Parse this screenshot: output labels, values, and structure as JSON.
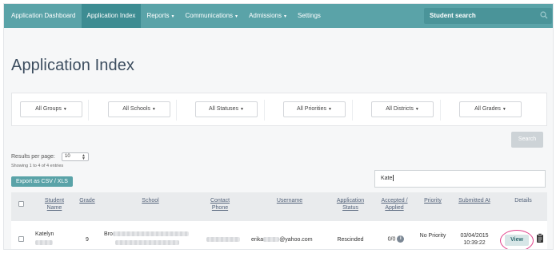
{
  "nav": {
    "items": [
      {
        "label": "Application Dashboard",
        "caret": false,
        "active": false
      },
      {
        "label": "Application Index",
        "caret": false,
        "active": true
      },
      {
        "label": "Reports",
        "caret": true,
        "active": false
      },
      {
        "label": "Communications",
        "caret": true,
        "active": false
      },
      {
        "label": "Admissions",
        "caret": true,
        "active": false
      },
      {
        "label": "Settings",
        "caret": false,
        "active": false
      }
    ],
    "search_placeholder": "Student search",
    "search_icon": "search-icon"
  },
  "page": {
    "title": "Application Index"
  },
  "filters": [
    {
      "label": "All Groups"
    },
    {
      "label": "All Schools"
    },
    {
      "label": "All Statuses"
    },
    {
      "label": "All Priorities"
    },
    {
      "label": "All Districts"
    },
    {
      "label": "All Grades"
    }
  ],
  "search_button": "Search",
  "results": {
    "per_page_label": "Results per page:",
    "per_page_value": "10",
    "entries_info": "Showing 1 to 4 of 4 entries",
    "export_label": "Export as CSV / XLS",
    "filter_value": "Kate"
  },
  "table": {
    "headers": {
      "student_name": "Student Name",
      "grade": "Grade",
      "school": "School",
      "contact_phone": "Contact Phone",
      "username": "Username",
      "application_status": "Application Status",
      "accepted_applied": "Accepted / Applied",
      "priority": "Priority",
      "submitted_at": "Submitted At",
      "details": "Details"
    },
    "rows": [
      {
        "student_name": "Katelyn",
        "grade": "9",
        "school_prefix": "Bro",
        "username_prefix": "erika",
        "username_suffix": "@yahoo.com",
        "application_status": "Rescinded",
        "accepted_applied": "0/0",
        "priority": "No Priority",
        "submitted_date": "03/04/2015",
        "submitted_time": "10:39:22",
        "view_label": "View"
      }
    ]
  },
  "colors": {
    "nav_bg": "#5aa3a8",
    "nav_active": "#3d8c92",
    "highlight": "#e0408a"
  }
}
